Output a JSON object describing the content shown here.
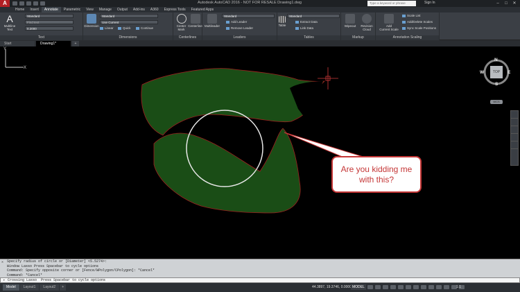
{
  "window": {
    "title": "Autodesk AutoCAD 2016 - NOT FOR RESALE   Drawing1.dwg",
    "search_placeholder": "Type a keyword or phrase",
    "sign_in": "Sign In"
  },
  "menu_tabs": [
    "Home",
    "Insert",
    "Annotate",
    "Parametric",
    "View",
    "Manage",
    "Output",
    "Add-ins",
    "A360",
    "Express Tools",
    "Featured Apps"
  ],
  "active_menu_tab": "Annotate",
  "ribbon": {
    "text_panel": {
      "label": "Text",
      "multiline_text": "Multiline\nText",
      "style": "Standard",
      "find_text": "Find text",
      "height": "0.2000"
    },
    "dimensions_panel": {
      "label": "Dimensions",
      "dimension": "Dimension",
      "dim_style": "Standard",
      "layer": "Use Current",
      "linear": "Linear",
      "quick": "Quick",
      "continue": "Continue"
    },
    "centerlines_panel": {
      "label": "Centerlines",
      "center_mark": "Center\nMark",
      "centerline": "Centerline"
    },
    "leaders_panel": {
      "label": "Leaders",
      "multileader": "Multileader",
      "style": "Standard",
      "add_leader": "Add Leader",
      "remove_leader": "Remove Leader"
    },
    "tables_panel": {
      "label": "Tables",
      "table": "Table",
      "style": "Standard",
      "extract_data": "Extract Data",
      "link_data": "Link Data"
    },
    "markup_panel": {
      "label": "Markup",
      "wipeout": "Wipeout",
      "revision_cloud": "Revision\nCloud"
    },
    "annotation_scaling_panel": {
      "label": "Annotation Scaling",
      "add_current_scale": "Add\nCurrent Scale",
      "scale_list": "Scale List",
      "add_delete_scales": "Add/Delete Scales",
      "sync_scale_positions": "Sync Scale Positions"
    }
  },
  "doc_tabs": [
    "Start",
    "Drawing1*"
  ],
  "active_doc_tab": "Drawing1*",
  "viewcube": {
    "n": "N",
    "s": "S",
    "e": "E",
    "w": "W",
    "face": "TOP",
    "wcs": "WCS"
  },
  "annotation": {
    "callout": "Are you kidding me with this?"
  },
  "colors": {
    "shape_fill": "#1a4d16",
    "shape_stroke": "#a02020",
    "circle": "#e8e8e8",
    "callout_border": "#c53636",
    "crosshair": "#d23a3a"
  },
  "command_history": [
    "Specify radius of circle or [Diameter] <5.5274>:",
    "Window Lasso  Press Spacebar to cycle options",
    "Command: Specify opposite corner or [Fence/WPolygon/CPolygon]: *Cancel*",
    "Command: *Cancel*"
  ],
  "command_line": "Crossing Lasso  Press Spacebar to cycle options",
  "layout_tabs": [
    "Model",
    "Layout1",
    "Layout2"
  ],
  "active_layout_tab": "Model",
  "status": {
    "coords": "44.3897, 19.3746, 0.0000",
    "model": "MODEL",
    "scale": "1:1"
  }
}
